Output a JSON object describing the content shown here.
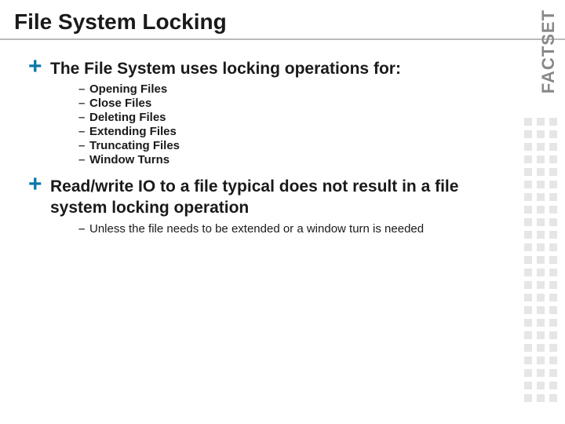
{
  "title": "File System Locking",
  "logo": "FACTSET",
  "bullets": [
    {
      "plus": "+",
      "text": "The File System uses locking operations for:",
      "subs": [
        {
          "dash": "–",
          "text": "Opening Files"
        },
        {
          "dash": "–",
          "text": "Close Files"
        },
        {
          "dash": "–",
          "text": "Deleting Files"
        },
        {
          "dash": "–",
          "text": "Extending Files"
        },
        {
          "dash": "–",
          "text": "Truncating Files"
        },
        {
          "dash": "–",
          "text": "Window Turns"
        }
      ]
    },
    {
      "plus": "+",
      "text": "Read/write IO to a file typical does not result in a file system locking operation",
      "subs": [
        {
          "dash": "–",
          "text": "Unless the file needs to be extended or a window turn is needed"
        }
      ]
    }
  ]
}
